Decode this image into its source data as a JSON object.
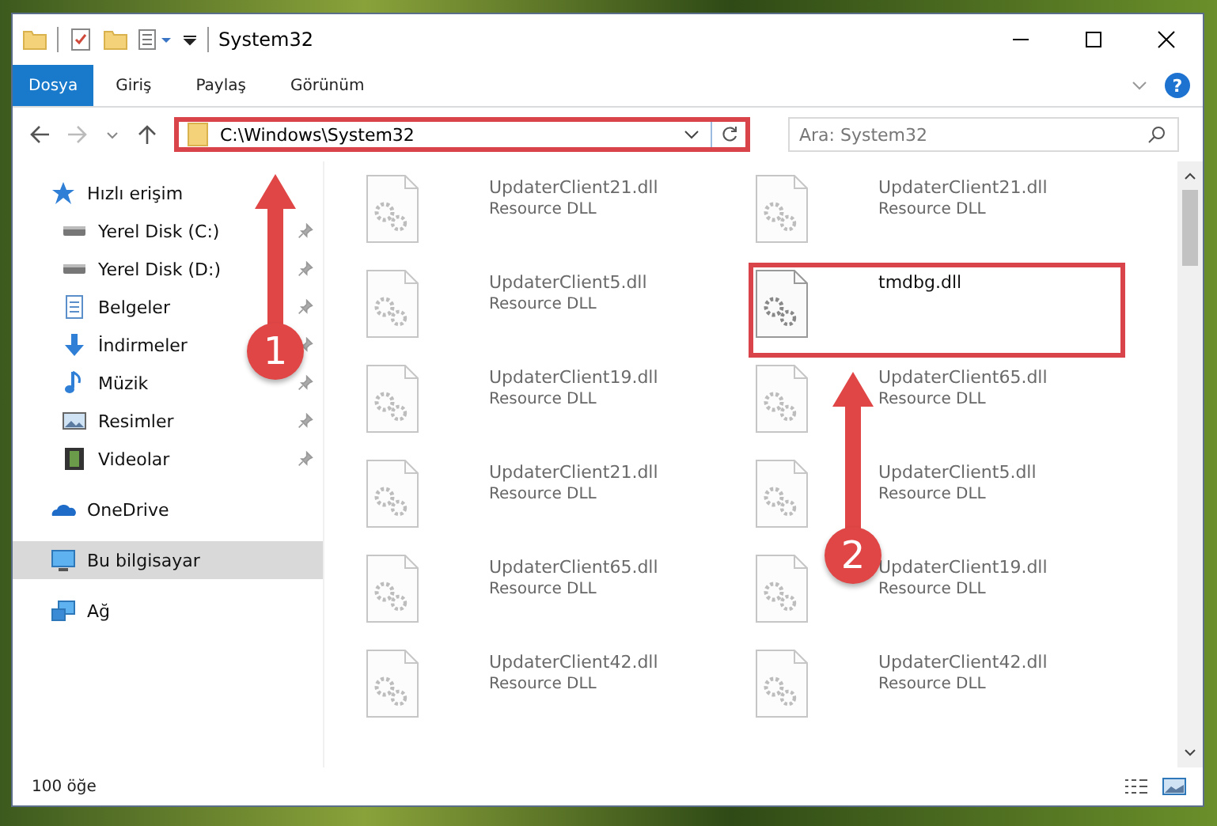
{
  "window": {
    "title": "System32"
  },
  "ribbon_tabs": [
    {
      "label": "Dosya",
      "selected": true
    },
    {
      "label": "Giriş",
      "selected": false
    },
    {
      "label": "Paylaş",
      "selected": false
    },
    {
      "label": "Görünüm",
      "selected": false
    }
  ],
  "help_button": {
    "label": "?"
  },
  "address_bar": {
    "path": "C:\\Windows\\System32",
    "highlighted": true
  },
  "search": {
    "placeholder": "Ara: System32"
  },
  "sidebar": {
    "items": [
      {
        "label": "Hızlı erişim",
        "selected": false,
        "children": [
          {
            "label": "Yerel Disk (C:)",
            "pinned": true,
            "selected": false
          },
          {
            "label": "Yerel Disk (D:)",
            "pinned": true,
            "selected": false
          },
          {
            "label": "Belgeler",
            "pinned": true,
            "selected": false
          },
          {
            "label": "İndirmeler",
            "pinned": true,
            "selected": false
          },
          {
            "label": "Müzik",
            "pinned": true,
            "selected": false
          },
          {
            "label": "Resimler",
            "pinned": true,
            "selected": false
          },
          {
            "label": "Videolar",
            "pinned": true,
            "selected": false
          }
        ]
      },
      {
        "label": "OneDrive",
        "selected": false
      },
      {
        "label": "Bu bilgisayar",
        "selected": true
      },
      {
        "label": "Ağ",
        "selected": false
      }
    ]
  },
  "files": [
    {
      "name": "UpdaterClient21.dll",
      "type": "Resource DLL",
      "blurred": true,
      "highlighted": false
    },
    {
      "name": "UpdaterClient21.dll",
      "type": "Resource DLL",
      "blurred": true,
      "highlighted": false
    },
    {
      "name": "UpdaterClient5.dll",
      "type": "Resource DLL",
      "blurred": true,
      "highlighted": false
    },
    {
      "name": "tmdbg.dll",
      "blurred": false,
      "highlighted": true
    },
    {
      "name": "UpdaterClient19.dll",
      "type": "Resource DLL",
      "blurred": true,
      "highlighted": false
    },
    {
      "name": "UpdaterClient65.dll",
      "type": "Resource DLL",
      "blurred": true,
      "highlighted": false
    },
    {
      "name": "UpdaterClient21.dll",
      "type": "Resource DLL",
      "blurred": true,
      "highlighted": false
    },
    {
      "name": "UpdaterClient5.dll",
      "type": "Resource DLL",
      "blurred": true,
      "highlighted": false
    },
    {
      "name": "UpdaterClient65.dll",
      "type": "Resource DLL",
      "blurred": true,
      "highlighted": false
    },
    {
      "name": "UpdaterClient19.dll",
      "type": "Resource DLL",
      "blurred": true,
      "highlighted": false
    },
    {
      "name": "UpdaterClient42.dll",
      "type": "Resource DLL",
      "blurred": true,
      "highlighted": false
    },
    {
      "name": "UpdaterClient42.dll",
      "type": "Resource DLL",
      "blurred": true,
      "highlighted": false
    }
  ],
  "status_bar": {
    "item_count": "100 öğe"
  },
  "annotations": [
    {
      "label": "1"
    },
    {
      "label": "2"
    }
  ]
}
